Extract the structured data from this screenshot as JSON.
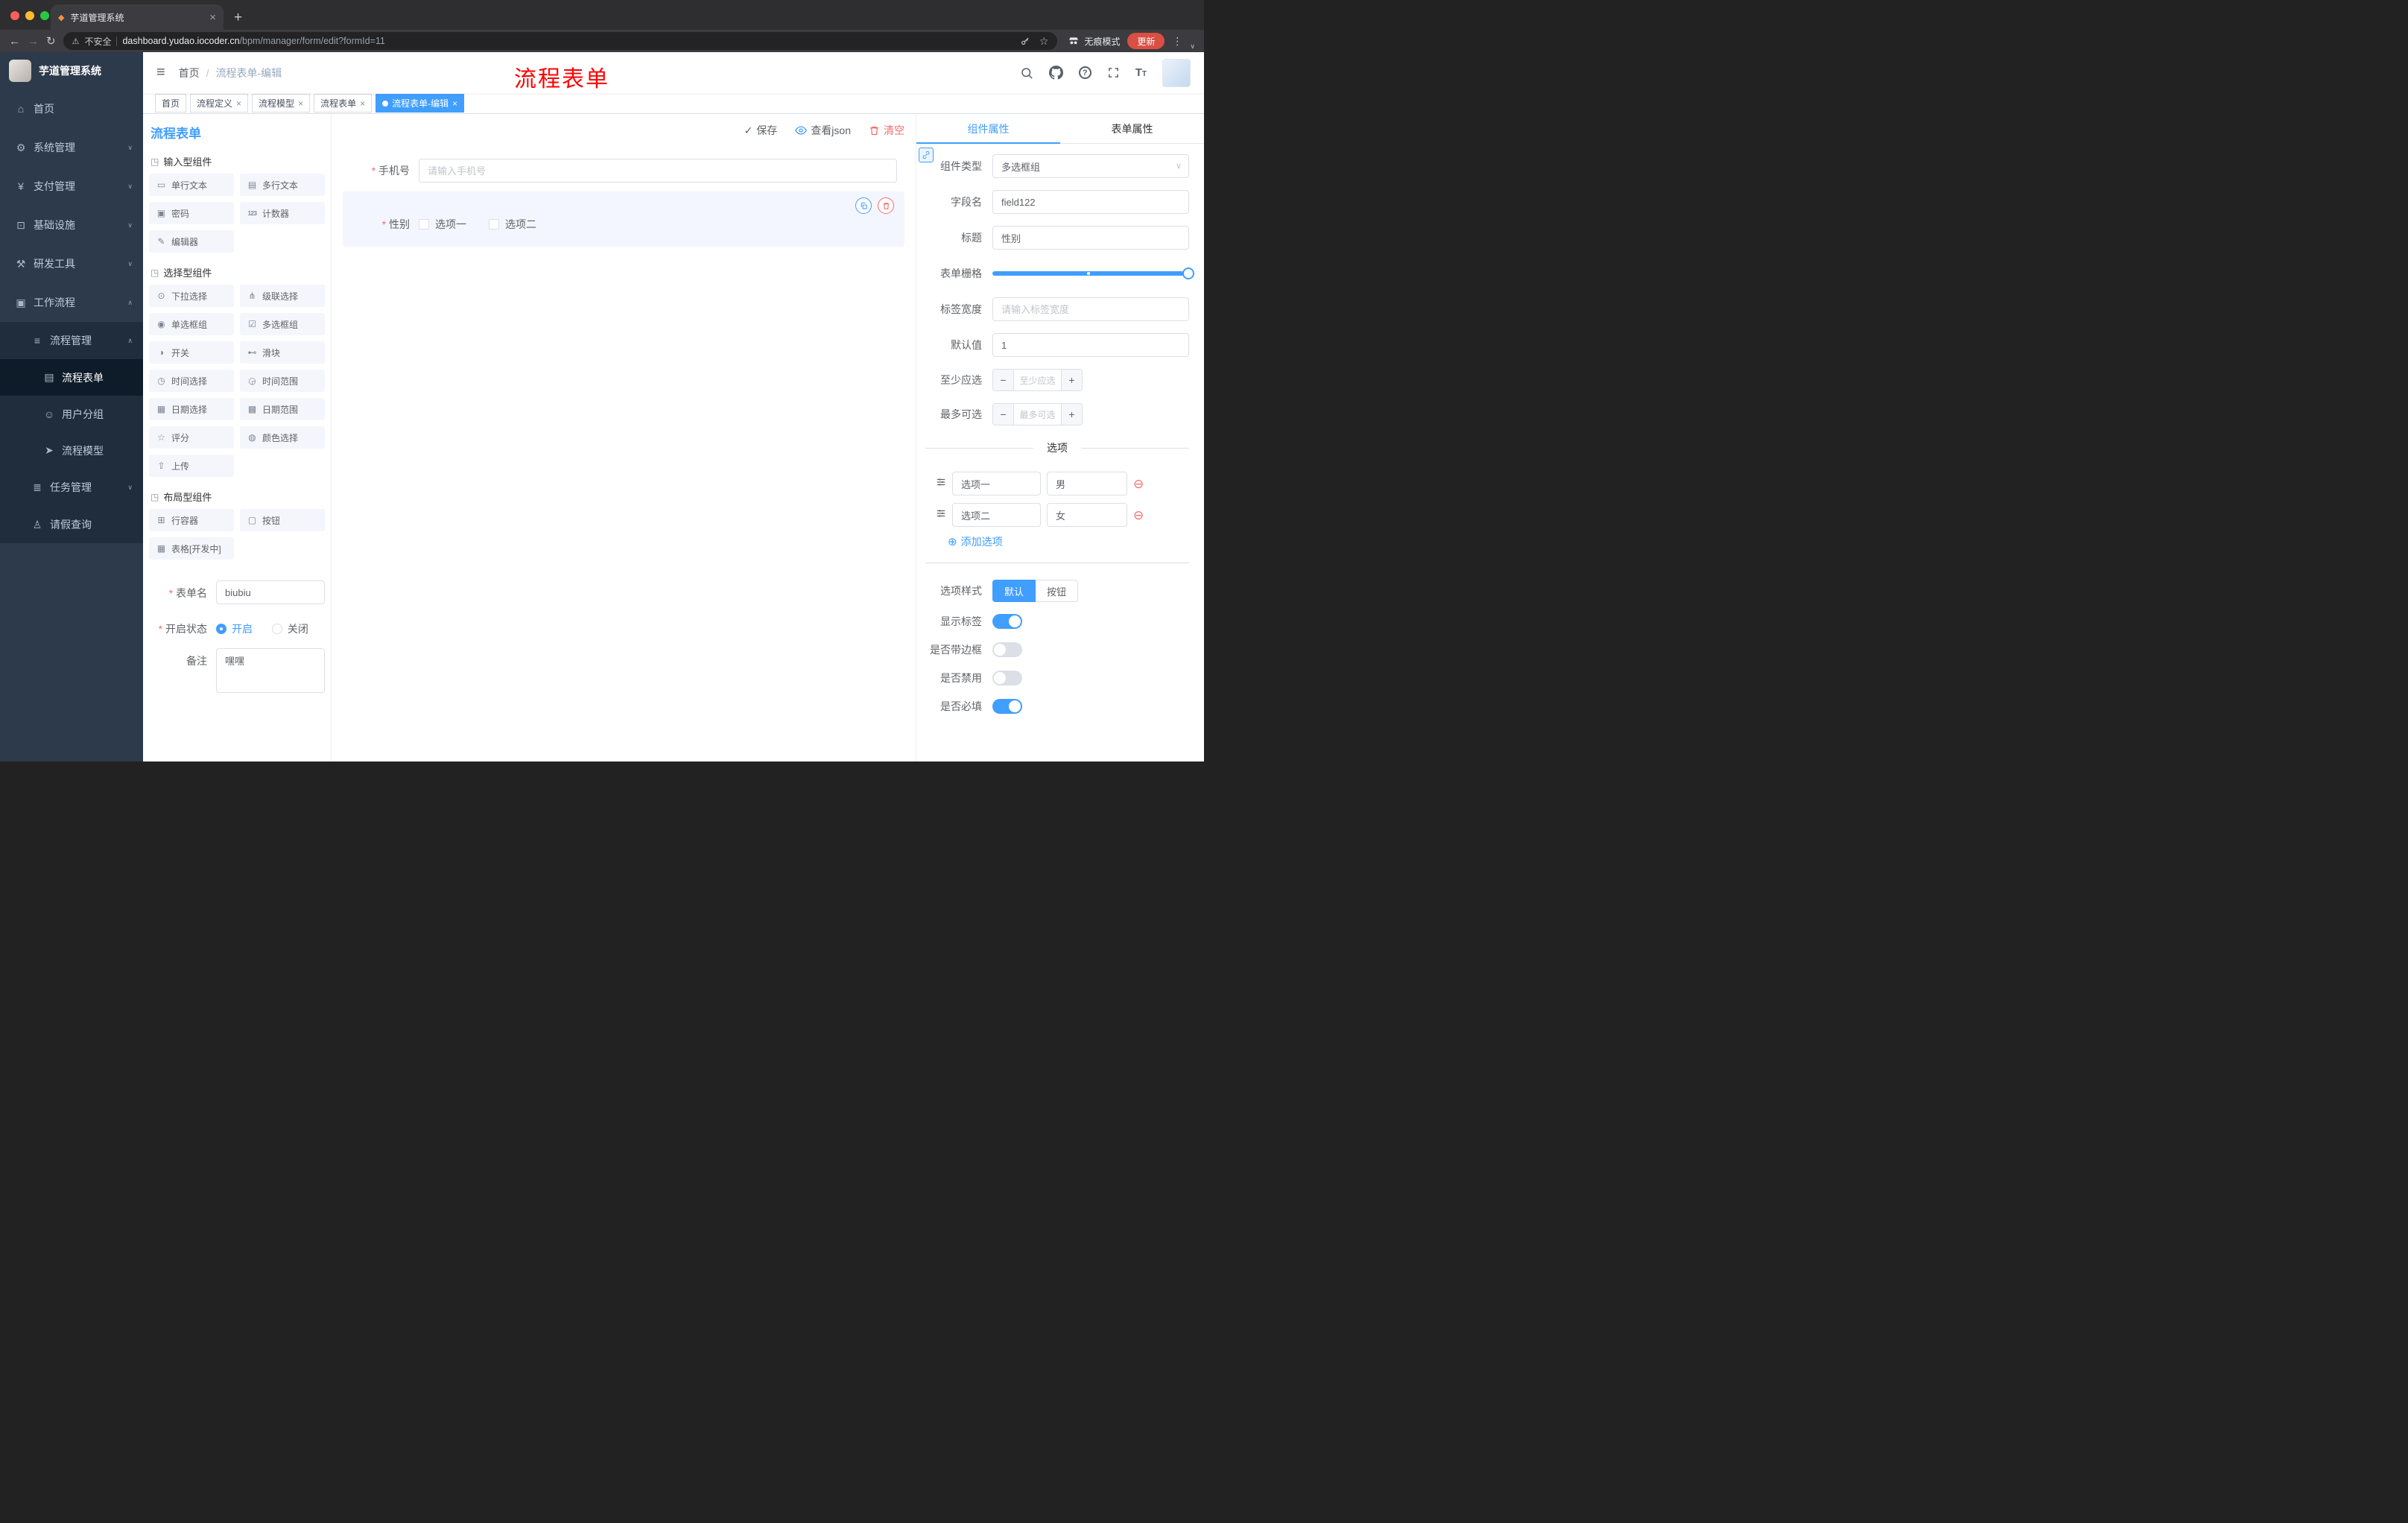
{
  "browser": {
    "tab_title": "芋道管理系统",
    "security_label": "不安全",
    "url_host": "dashboard.yudao.iocoder.cn",
    "url_path": "/bpm/manager/form/edit?formId=11",
    "incognito_label": "无痕模式",
    "update_label": "更新"
  },
  "sidebar": {
    "logo_title": "芋道管理系统",
    "items": [
      {
        "label": "首页",
        "icon": "⌂"
      },
      {
        "label": "系统管理",
        "icon": "⚙"
      },
      {
        "label": "支付管理",
        "icon": "¥"
      },
      {
        "label": "基础设施",
        "icon": "⊡"
      },
      {
        "label": "研发工具",
        "icon": "⚒"
      },
      {
        "label": "工作流程",
        "icon": "▣"
      }
    ],
    "process_mgmt": {
      "label": "流程管理",
      "icon": "≡"
    },
    "process_children": [
      {
        "label": "流程表单",
        "icon": "▤"
      },
      {
        "label": "用户分组",
        "icon": "☺"
      },
      {
        "label": "流程模型",
        "icon": "➤"
      }
    ],
    "task_mgmt": {
      "label": "任务管理",
      "icon": "≣"
    },
    "leave_query": {
      "label": "请假查询",
      "icon": "♙"
    }
  },
  "navbar": {
    "breadcrumb_home": "首页",
    "breadcrumb_sep": "/",
    "breadcrumb_current": "流程表单-编辑",
    "annotation": "流程表单"
  },
  "tags": [
    {
      "label": "首页",
      "closable": false,
      "active": false
    },
    {
      "label": "流程定义",
      "closable": true,
      "active": false
    },
    {
      "label": "流程模型",
      "closable": true,
      "active": false
    },
    {
      "label": "流程表单",
      "closable": true,
      "active": false
    },
    {
      "label": "流程表单-编辑",
      "closable": true,
      "active": true
    }
  ],
  "designer": {
    "title": "流程表单",
    "save": "保存",
    "view_json": "查看json",
    "clear": "清空"
  },
  "palette": {
    "groups": [
      {
        "title": "输入型组件",
        "icon": "◳",
        "items": [
          {
            "label": "单行文本",
            "icon": "▭"
          },
          {
            "label": "多行文本",
            "icon": "▤"
          },
          {
            "label": "密码",
            "icon": "▣"
          },
          {
            "label": "计数器",
            "icon": "123"
          },
          {
            "label": "编辑器",
            "icon": "✎"
          }
        ]
      },
      {
        "title": "选择型组件",
        "icon": "◳",
        "items": [
          {
            "label": "下拉选择",
            "icon": "⊙"
          },
          {
            "label": "级联选择",
            "icon": "⋔"
          },
          {
            "label": "单选框组",
            "icon": "◉"
          },
          {
            "label": "多选框组",
            "icon": "☑"
          },
          {
            "label": "开关",
            "icon": "◑"
          },
          {
            "label": "滑块",
            "icon": "⊷"
          },
          {
            "label": "时间选择",
            "icon": "◷"
          },
          {
            "label": "时间范围",
            "icon": "◶"
          },
          {
            "label": "日期选择",
            "icon": "▦"
          },
          {
            "label": "日期范围",
            "icon": "▩"
          },
          {
            "label": "评分",
            "icon": "☆"
          },
          {
            "label": "颜色选择",
            "icon": "◍"
          },
          {
            "label": "上传",
            "icon": "⇧"
          }
        ]
      },
      {
        "title": "布局型组件",
        "icon": "◳",
        "items": [
          {
            "label": "行容器",
            "icon": "⊞"
          },
          {
            "label": "按钮",
            "icon": "▢"
          },
          {
            "label": "表格[开发中]",
            "icon": "▦"
          }
        ]
      }
    ]
  },
  "meta": {
    "name_label": "表单名",
    "name_value": "biubiu",
    "status_label": "开启状态",
    "status_on": "开启",
    "status_off": "关闭",
    "remark_label": "备注",
    "remark_value": "嘿嘿"
  },
  "canvas": {
    "phone_label": "手机号",
    "phone_placeholder": "请输入手机号",
    "gender_label": "性别",
    "gender_opt1": "选项一",
    "gender_opt2": "选项二"
  },
  "props": {
    "tab_component": "组件属性",
    "tab_form": "表单属性",
    "type_label": "组件类型",
    "type_value": "多选框组",
    "field_label": "字段名",
    "field_value": "field122",
    "title_label": "标题",
    "title_value": "性别",
    "grid_label": "表单栅格",
    "width_label": "标签宽度",
    "width_placeholder": "请输入标签宽度",
    "default_label": "默认值",
    "default_value": "1",
    "min_label": "至少应选",
    "min_placeholder": "至少应选",
    "max_label": "最多可选",
    "max_placeholder": "最多可选",
    "options_title": "选项",
    "options": [
      {
        "label": "选项一",
        "value": "男"
      },
      {
        "label": "选项二",
        "value": "女"
      }
    ],
    "add_option": "添加选项",
    "style_label": "选项样式",
    "style_default": "默认",
    "style_button": "按钮",
    "switch_show_label": "显示标签",
    "switch_border": "是否带边框",
    "switch_disabled": "是否禁用",
    "switch_required": "是否必填"
  },
  "colors": {
    "primary": "#409EFF",
    "danger": "#F56C6C",
    "annotation": "#FF0000",
    "sidebar_bg": "#2D3A4B",
    "sidebar_sub_bg": "#1F2D3D",
    "update_pill": "#D94F43"
  }
}
